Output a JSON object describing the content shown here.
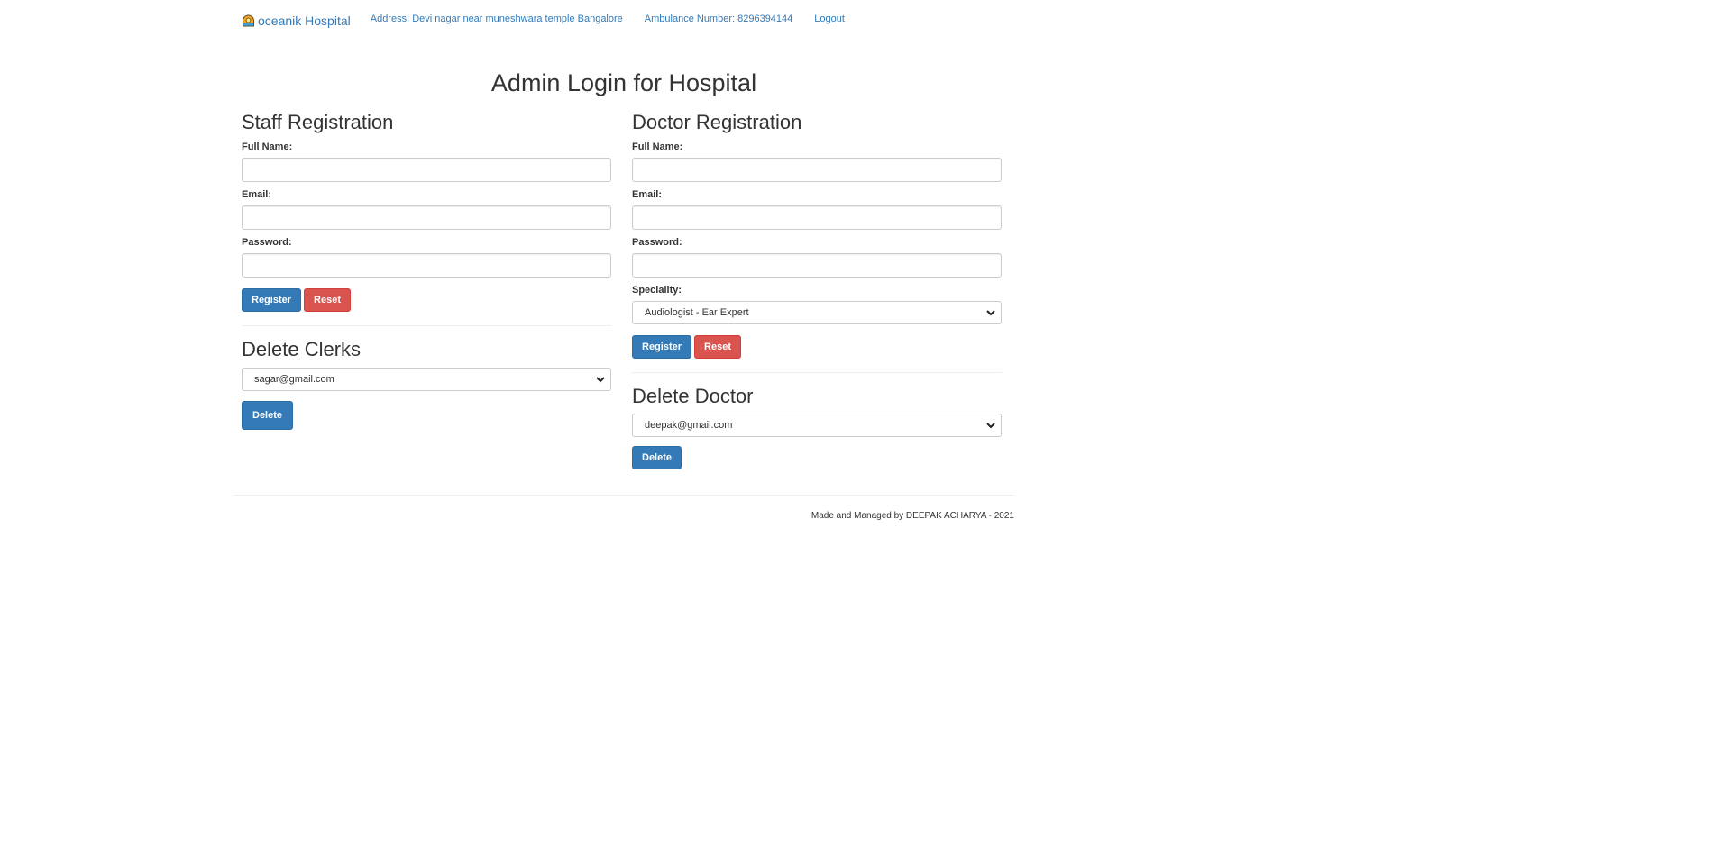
{
  "navbar": {
    "brand": "oceanik Hospital",
    "links": [
      "Address: Devi nagar near muneshwara temple Bangalore",
      "Ambulance Number: 8296394144",
      "Logout"
    ]
  },
  "page": {
    "title": "Admin Login for Hospital"
  },
  "staff_registration": {
    "title": "Staff Registration",
    "full_name_label": "Full Name:",
    "email_label": "Email:",
    "password_label": "Password:",
    "full_name_value": "",
    "email_value": "",
    "password_value": "",
    "register_label": "Register",
    "reset_label": "Reset"
  },
  "delete_clerks": {
    "title": "Delete Clerks",
    "selected": "sagar@gmail.com",
    "delete_label": "Delete"
  },
  "doctor_registration": {
    "title": "Doctor Registration",
    "full_name_label": "Full Name:",
    "email_label": "Email:",
    "password_label": "Password:",
    "speciality_label": "Speciality:",
    "full_name_value": "",
    "email_value": "",
    "password_value": "",
    "speciality_selected": "Audiologist - Ear Expert",
    "register_label": "Register",
    "reset_label": "Reset"
  },
  "delete_doctor": {
    "title": "Delete Doctor",
    "selected": "deepak@gmail.com",
    "delete_label": "Delete"
  },
  "footer": {
    "text": "Made and Managed by DEEPAK ACHARYA - 2021"
  },
  "colors": {
    "link": "#337ab7",
    "primary": "#337ab7",
    "danger": "#d9534f"
  },
  "icons": {
    "brand": "hospital-logo-icon",
    "select": "chevron-down-icon"
  }
}
